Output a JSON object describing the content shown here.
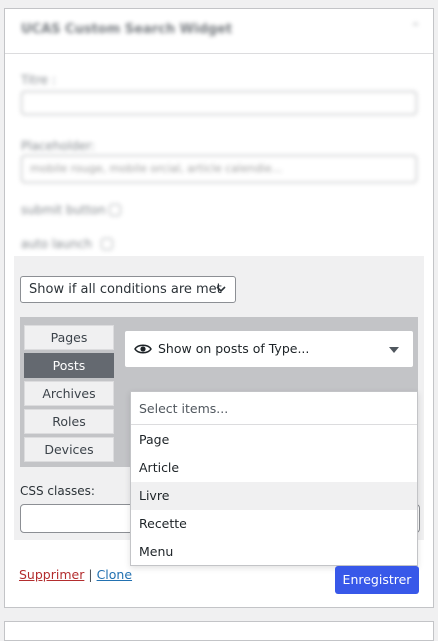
{
  "widget": {
    "title": "UCAS Custom Search Widget",
    "fields": {
      "title_label": "Titre :",
      "placeholder_label": "Placeholder:",
      "placeholder_value": "mobile rouge, mobile orcial, article calendie...",
      "submit_label": "submit button",
      "auto_search_label": "auto launch"
    }
  },
  "conditions": {
    "mode": "Show if all conditions are met",
    "tabs": [
      "Pages",
      "Posts",
      "Archives",
      "Roles",
      "Devices"
    ],
    "active_tab": "Posts",
    "type_select": "Show on posts of Type...",
    "dropdown": {
      "placeholder": "Select items...",
      "items": [
        "Page",
        "Article",
        "Livre",
        "Recette",
        "Menu"
      ],
      "highlighted": "Livre"
    },
    "css_label": "CSS classes:"
  },
  "footer": {
    "delete": "Supprimer",
    "separator": "|",
    "clone": "Clone",
    "save": "Enregistrer"
  },
  "colors": {
    "save_button": "#3858e9",
    "active_tab": "#646970",
    "delete_link": "#b32d2e",
    "clone_link": "#2271b1"
  }
}
